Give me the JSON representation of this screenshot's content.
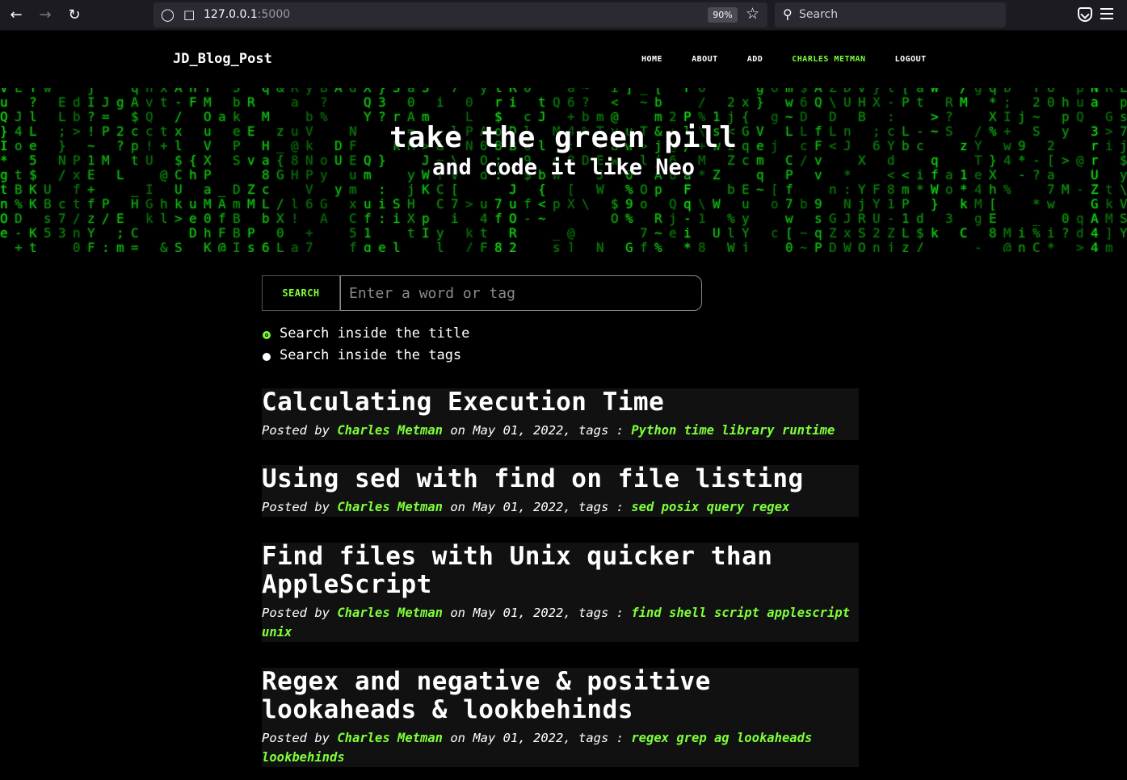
{
  "browser": {
    "url_host": "127.0.0.1",
    "url_port": ":5000",
    "zoom": "90%",
    "search_placeholder": "Search"
  },
  "site": {
    "brand": "JD_Blog_Post",
    "nav": [
      {
        "label": "HOME"
      },
      {
        "label": "ABOUT"
      },
      {
        "label": "ADD"
      },
      {
        "label": "CHARLES METMAN",
        "active": true
      },
      {
        "label": "LOGOUT"
      }
    ],
    "accent_color": "#7dff3a"
  },
  "hero": {
    "title": "take the green pill",
    "subtitle": "and code it like Neo"
  },
  "search": {
    "button_label": "SEARCH",
    "placeholder": "Enter a word or tag",
    "options": [
      {
        "label": "Search inside the title",
        "selected": true
      },
      {
        "label": "Search inside the tags",
        "selected": false
      }
    ]
  },
  "posts": [
    {
      "title": "Calculating Execution Time",
      "posted_by": "Posted by",
      "author": "Charles Metman",
      "on": "on May 01, 2022, tags :",
      "tags": "Python time library runtime"
    },
    {
      "title": "Using sed with find on file listing",
      "posted_by": "Posted by",
      "author": "Charles Metman",
      "on": "on May 01, 2022, tags :",
      "tags": "sed posix query regex"
    },
    {
      "title": "Find files with Unix quicker than AppleScript",
      "posted_by": "Posted by",
      "author": "Charles Metman",
      "on": "on May 01, 2022, tags :",
      "tags": "find shell script applescript unix"
    },
    {
      "title": "Regex and negative & positive lookaheads & lookbehinds",
      "posted_by": "Posted by",
      "author": "Charles Metman",
      "on": "on May 01, 2022, tags :",
      "tags": "regex grep ag lookaheads lookbehinds"
    }
  ]
}
